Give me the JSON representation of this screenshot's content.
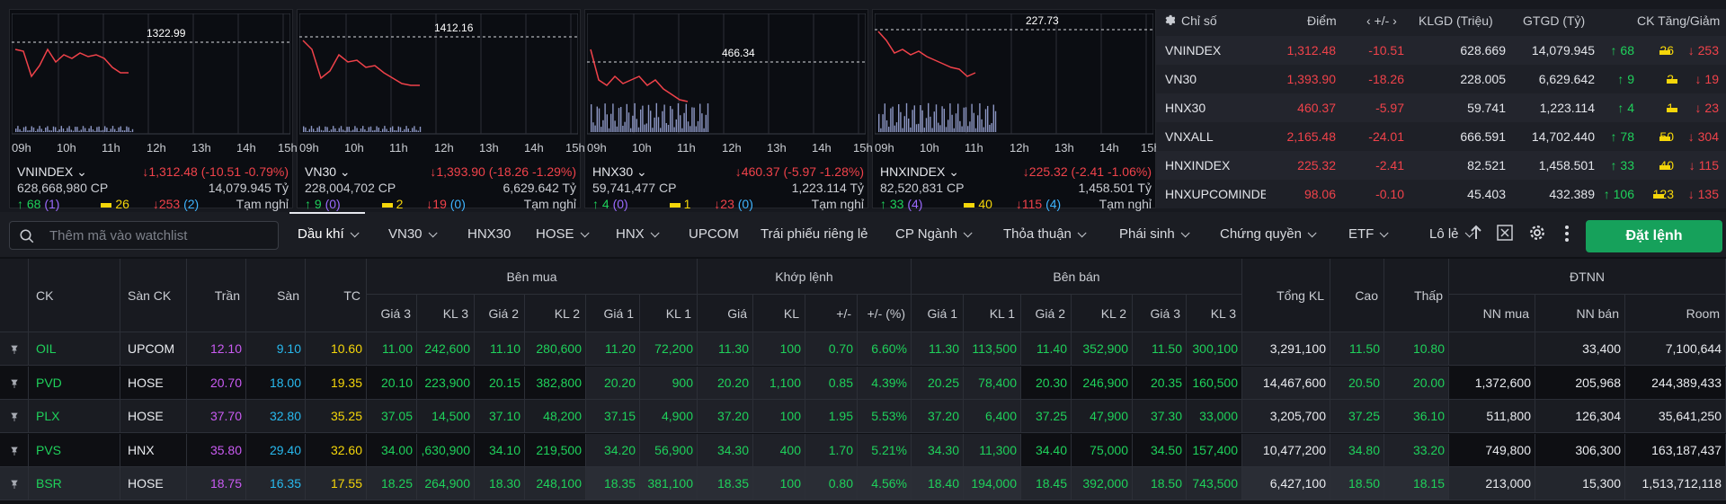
{
  "mini_charts": [
    {
      "ref_value": "1322.99",
      "name": "VNINDEX",
      "volume": "628,668,980 CP",
      "change": "↓1,312.48 (-10.51 -0.79%)",
      "value": "14,079.945 Tỷ",
      "adv": "68",
      "adv_ceil": "(1)",
      "unch": "26",
      "dec": "253",
      "dec_floor": "(2)",
      "status": "Tạm nghỉ"
    },
    {
      "ref_value": "1412.16",
      "name": "VN30",
      "volume": "228,004,702 CP",
      "change": "↓1,393.90 (-18.26 -1.29%)",
      "value": "6,629.642 Tỷ",
      "adv": "9",
      "adv_ceil": "(0)",
      "unch": "2",
      "dec": "19",
      "dec_floor": "(0)",
      "status": "Tạm nghỉ"
    },
    {
      "ref_value": "466.34",
      "name": "HNX30",
      "volume": "59,741,477 CP",
      "change": "↓460.37 (-5.97 -1.28%)",
      "value": "1,223.114 Tỷ",
      "adv": "4",
      "adv_ceil": "(0)",
      "unch": "1",
      "dec": "23",
      "dec_floor": "(0)",
      "status": "Tạm nghỉ"
    },
    {
      "ref_value": "227.73",
      "name": "HNXINDEX",
      "volume": "82,520,831 CP",
      "change": "↓225.32 (-2.41 -1.06%)",
      "value": "1,458.501 Tỷ",
      "adv": "33",
      "adv_ceil": "(4)",
      "unch": "40",
      "dec": "115",
      "dec_floor": "(4)",
      "status": "Tạm nghỉ"
    }
  ],
  "time_labels": [
    "09h",
    "10h",
    "11h",
    "12h",
    "13h",
    "14h",
    "15h"
  ],
  "index_table": {
    "headers": {
      "index": "Chỉ số",
      "point": "Điểm",
      "change": "+/-",
      "volume": "KLGD (Triệu)",
      "value": "GTGD (Tỷ)",
      "breadth": "CK Tăng/Giảm"
    },
    "rows": [
      {
        "name": "VNINDEX",
        "point": "1,312.48",
        "change": "-10.51",
        "volume": "628.669",
        "value": "14,079.945",
        "up": "68",
        "unch": "26",
        "down": "253"
      },
      {
        "name": "VN30",
        "point": "1,393.90",
        "change": "-18.26",
        "volume": "228.005",
        "value": "6,629.642",
        "up": "9",
        "unch": "2",
        "down": "19"
      },
      {
        "name": "HNX30",
        "point": "460.37",
        "change": "-5.97",
        "volume": "59.741",
        "value": "1,223.114",
        "up": "4",
        "unch": "1",
        "down": "23"
      },
      {
        "name": "VNXALL",
        "point": "2,165.48",
        "change": "-24.01",
        "volume": "666.591",
        "value": "14,702.440",
        "up": "78",
        "unch": "50",
        "down": "304"
      },
      {
        "name": "HNXINDEX",
        "point": "225.32",
        "change": "-2.41",
        "volume": "82.521",
        "value": "1,458.501",
        "up": "33",
        "unch": "40",
        "down": "115"
      },
      {
        "name": "HNXUPCOMINDE",
        "point": "98.06",
        "change": "-0.10",
        "volume": "45.403",
        "value": "432.389",
        "up": "106",
        "unch": "123",
        "down": "135"
      }
    ]
  },
  "toolbar": {
    "search_placeholder": "Thêm mã vào watchlist",
    "tabs": [
      "Dầu khí",
      "VN30",
      "HNX30",
      "HOSE",
      "HNX",
      "UPCOM",
      "Trái phiếu riêng lẻ",
      "CP Ngành",
      "Thỏa thuận",
      "Phái sinh",
      "Chứng quyền",
      "ETF",
      "Lô lẻ"
    ],
    "order_button": "Đặt lệnh"
  },
  "table": {
    "group_headers": {
      "buy": "Bên mua",
      "match": "Khớp lệnh",
      "sell": "Bên bán",
      "foreign": "ĐTNN"
    },
    "columns": {
      "ck": "CK",
      "exchange": "Sàn CK",
      "ceil": "Trần",
      "floor": "Sàn",
      "ref": "TC",
      "b3": "Giá 3",
      "bv3": "KL 3",
      "b2": "Giá 2",
      "bv2": "KL 2",
      "b1": "Giá 1",
      "bv1": "KL 1",
      "mp": "Giá",
      "mv": "KL",
      "mc": "+/-",
      "mpct": "+/- (%)",
      "s1": "Giá 1",
      "sv1": "KL 1",
      "s2": "Giá 2",
      "sv2": "KL 2",
      "s3": "Giá 3",
      "sv3": "KL 3",
      "total": "Tổng KL",
      "high": "Cao",
      "low": "Thấp",
      "nn_buy": "NN mua",
      "nn_sell": "NN bán",
      "room": "Room"
    },
    "rows": [
      {
        "ck": "OIL",
        "exchange": "UPCOM",
        "ceil": "12.10",
        "floor": "9.10",
        "ref": "10.60",
        "b3": "11.00",
        "bv3": "242,600",
        "b2": "11.10",
        "bv2": "280,600",
        "b1": "11.20",
        "bv1": "72,200",
        "mp": "11.30",
        "mv": "100",
        "mc": "0.70",
        "mpct": "6.60%",
        "s1": "11.30",
        "sv1": "113,500",
        "s2": "11.40",
        "sv2": "352,900",
        "s3": "11.50",
        "sv3": "300,100",
        "total": "3,291,100",
        "high": "11.50",
        "low": "10.80",
        "nn_buy": "",
        "nn_sell": "33,400",
        "room": "7,100,644"
      },
      {
        "ck": "PVD",
        "exchange": "HOSE",
        "ceil": "20.70",
        "floor": "18.00",
        "ref": "19.35",
        "b3": "20.10",
        "bv3": "223,900",
        "b2": "20.15",
        "bv2": "382,800",
        "b1": "20.20",
        "bv1": "900",
        "mp": "20.20",
        "mv": "1,100",
        "mc": "0.85",
        "mpct": "4.39%",
        "s1": "20.25",
        "sv1": "78,400",
        "s2": "20.30",
        "sv2": "246,900",
        "s3": "20.35",
        "sv3": "160,500",
        "total": "14,467,600",
        "high": "20.50",
        "low": "20.00",
        "nn_buy": "1,372,600",
        "nn_sell": "205,968",
        "room": "244,389,433"
      },
      {
        "ck": "PLX",
        "exchange": "HOSE",
        "ceil": "37.70",
        "floor": "32.80",
        "ref": "35.25",
        "b3": "37.05",
        "bv3": "14,500",
        "b2": "37.10",
        "bv2": "48,200",
        "b1": "37.15",
        "bv1": "4,900",
        "mp": "37.20",
        "mv": "100",
        "mc": "1.95",
        "mpct": "5.53%",
        "s1": "37.20",
        "sv1": "6,400",
        "s2": "37.25",
        "sv2": "47,900",
        "s3": "37.30",
        "sv3": "33,000",
        "total": "3,205,700",
        "high": "37.25",
        "low": "36.10",
        "nn_buy": "511,800",
        "nn_sell": "126,304",
        "room": "35,641,250"
      },
      {
        "ck": "PVS",
        "exchange": "HNX",
        "ceil": "35.80",
        "floor": "29.40",
        "ref": "32.60",
        "b3": "34.00",
        "bv3": ",630,900",
        "b2": "34.10",
        "bv2": "219,500",
        "b1": "34.20",
        "bv1": "56,900",
        "mp": "34.30",
        "mv": "400",
        "mc": "1.70",
        "mpct": "5.21%",
        "s1": "34.30",
        "sv1": "11,300",
        "s2": "34.40",
        "sv2": "75,000",
        "s3": "34.50",
        "sv3": "157,400",
        "total": "10,477,200",
        "high": "34.80",
        "low": "33.20",
        "nn_buy": "749,800",
        "nn_sell": "306,300",
        "room": "163,187,437"
      },
      {
        "ck": "BSR",
        "exchange": "HOSE",
        "ceil": "18.75",
        "floor": "16.35",
        "ref": "17.55",
        "b3": "18.25",
        "bv3": "264,900",
        "b2": "18.30",
        "bv2": "248,100",
        "b1": "18.35",
        "bv1": "381,100",
        "mp": "18.35",
        "mv": "100",
        "mc": "0.80",
        "mpct": "4.56%",
        "s1": "18.40",
        "sv1": "194,000",
        "s2": "18.45",
        "sv2": "392,000",
        "s3": "18.50",
        "sv3": "743,500",
        "total": "6,427,100",
        "high": "18.50",
        "low": "18.15",
        "nn_buy": "213,000",
        "nn_sell": "15,300",
        "room": "1,513,712,118"
      }
    ]
  },
  "colors": {
    "up": "#1fd15b",
    "down": "#f0424a",
    "ref": "#f5d60a",
    "ceil": "#c95bf2",
    "floor": "#28b9ee",
    "accent": "#16a15b"
  }
}
